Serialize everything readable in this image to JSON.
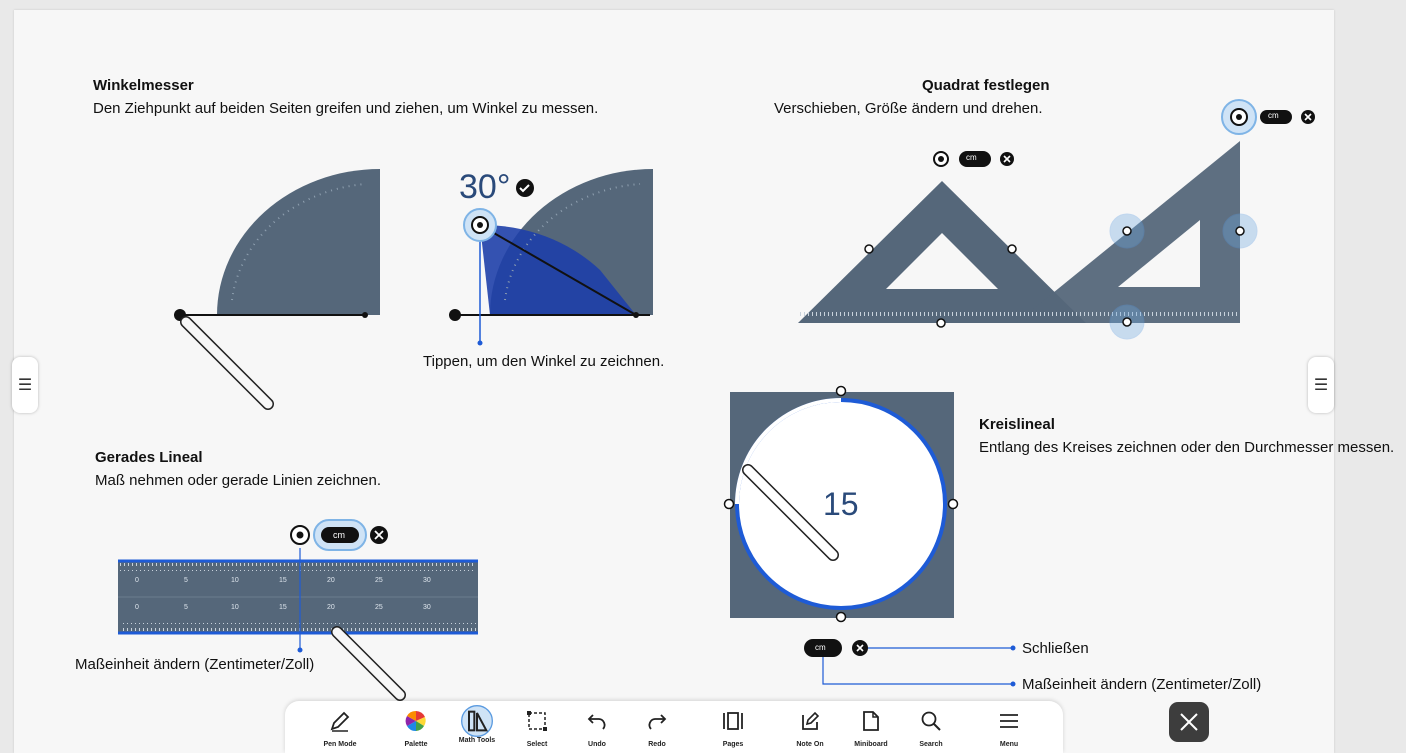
{
  "left_handle_icon": "menu-icon",
  "right_handle_icon": "menu-icon",
  "protractor": {
    "title": "Winkelmesser",
    "description": "Den Ziehpunkt auf beiden Seiten greifen und ziehen, um Winkel zu messen.",
    "angle_value": "30°",
    "hint": "Tippen, um den Winkel zu zeichnen."
  },
  "square": {
    "title": "Quadrat festlegen",
    "description": "Verschieben, Größe ändern und drehen.",
    "unit_badge": "cm"
  },
  "ruler": {
    "title": "Gerades Lineal",
    "description": "Maß nehmen oder gerade Linien zeichnen.",
    "unit_badge": "cm",
    "unit_hint": "Maßeinheit ändern (Zentimeter/Zoll)",
    "tick_labels": [
      "0",
      "5",
      "10",
      "15",
      "20",
      "25",
      "30"
    ]
  },
  "circle": {
    "title": "Kreislineal",
    "description": "Entlang des Kreises zeichnen oder den Durchmesser messen.",
    "diameter_value": "15",
    "unit_badge": "cm",
    "close_label": "Schließen",
    "unit_hint": "Maßeinheit ändern (Zentimeter/Zoll)"
  },
  "toolbar": {
    "tools": [
      {
        "label": "Pen Mode",
        "icon": "pen-icon"
      },
      {
        "label": "Palette",
        "icon": "palette-icon"
      },
      {
        "label": "Math Tools",
        "icon": "math-tools-icon",
        "active": true
      },
      {
        "label": "Select",
        "icon": "select-icon"
      },
      {
        "label": "Undo",
        "icon": "undo-icon"
      },
      {
        "label": "Redo",
        "icon": "redo-icon"
      },
      {
        "label": "Pages",
        "icon": "pages-icon"
      },
      {
        "label": "Note On",
        "icon": "note-on-icon"
      },
      {
        "label": "Miniboard",
        "icon": "miniboard-icon"
      },
      {
        "label": "Search",
        "icon": "search-icon"
      },
      {
        "label": "Menu",
        "icon": "menu-icon"
      }
    ]
  },
  "colors": {
    "tool_gray": "#55677a",
    "accent_blue": "#1e5bd6",
    "dark": "#222222"
  }
}
